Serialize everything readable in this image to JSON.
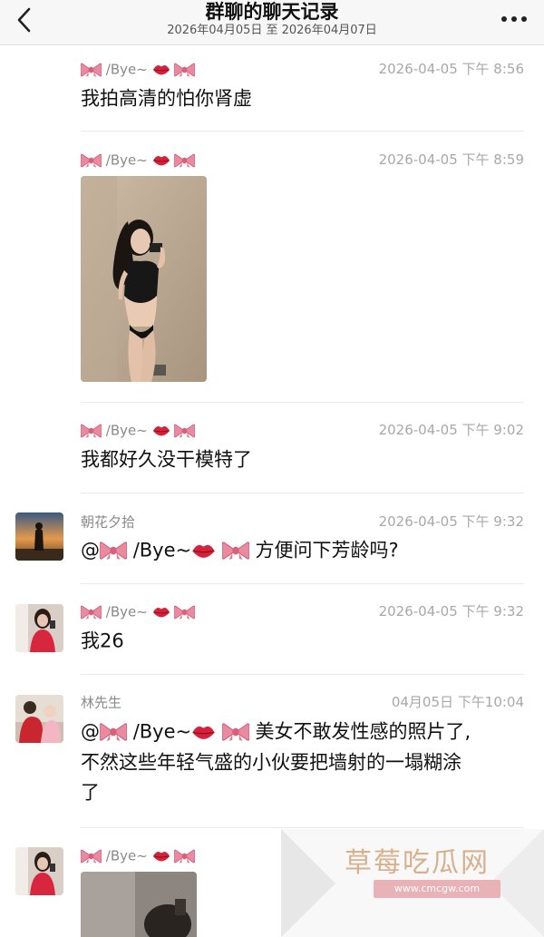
{
  "header": {
    "title": "群聊的聊天记录",
    "subtitle": "2026年04月05日 至 2026年04月07日",
    "back_icon": "chevron-left-icon",
    "more_icon": "more-dots-icon"
  },
  "messages": [
    {
      "sender": "/Bye~",
      "time": "2026-04-05 下午 8:56",
      "text": "我拍高清的怕你肾虚"
    },
    {
      "sender": "/Bye~",
      "time": "2026-04-05 下午 8:59",
      "type": "image"
    },
    {
      "sender": "/Bye~",
      "time": "2026-04-05 下午 9:02",
      "text": "我都好久没干模特了"
    },
    {
      "sender": "朝花夕拾",
      "time": "2026-04-05 下午 9:32",
      "mention": "@",
      "mention_name": "/Bye~",
      "text": "方便问下芳龄吗?"
    },
    {
      "sender": "/Bye~",
      "time": "2026-04-05 下午 9:32",
      "text": "我26"
    },
    {
      "sender": "林先生",
      "time": "04月05日 下午10:04",
      "mention": "@",
      "mention_name": "/Bye~",
      "text": "美女不敢发性感的照片了,",
      "text2": "不然这些年轻气盛的小伙要把墙射的一塌糊涂",
      "text3": "了"
    },
    {
      "sender": "/Bye~",
      "type": "image"
    }
  ],
  "watermark": {
    "text": "草莓吃瓜网",
    "url": "www.cmcgw.com"
  },
  "colors": {
    "header_bg": "#f7f7f7",
    "bow": "#e47c92",
    "lips": "#d6213a",
    "meta_text": "#a8a8a8"
  }
}
